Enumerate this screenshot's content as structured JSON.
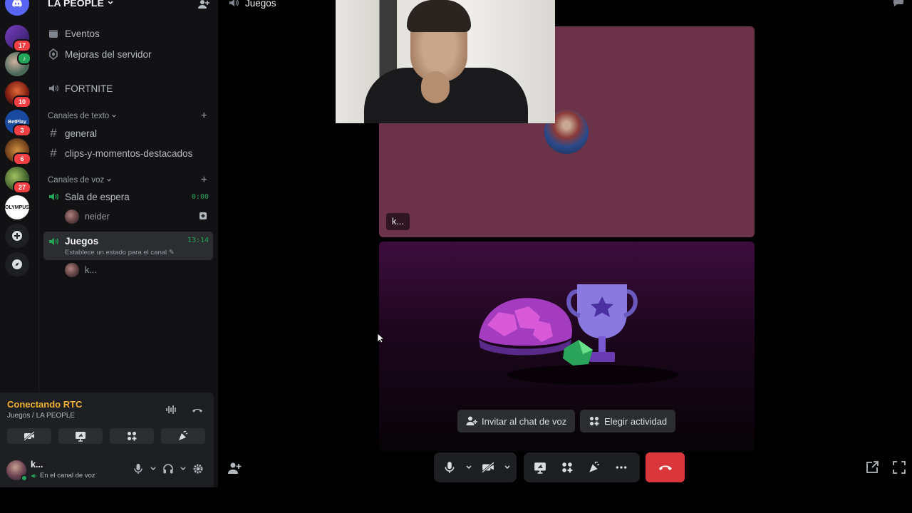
{
  "server": {
    "name": "LA PEOPLE",
    "rail": [
      {
        "name": "server-1",
        "badge": "17",
        "color": "#6b2fa5"
      },
      {
        "name": "server-2",
        "badge": "",
        "color": "#3a6a4a"
      },
      {
        "name": "server-3",
        "badge": "10",
        "color": "#8a2a1a"
      },
      {
        "name": "server-betplay",
        "badge": "3",
        "color": "#1a4aa0"
      },
      {
        "name": "server-5",
        "badge": "6",
        "color": "#8a5a2a"
      },
      {
        "name": "server-6",
        "badge": "27",
        "color": "#5a7a3a"
      },
      {
        "name": "server-olympus",
        "badge": "",
        "color": "#ffffff"
      }
    ]
  },
  "sidebar": {
    "events": "Eventos",
    "boosts": "Mejoras del servidor",
    "fortnite": "FORTNITE",
    "text_category": "Canales de texto",
    "text_channels": [
      "general",
      "clips-y-momentos-destacados"
    ],
    "voice_category": "Canales de voz",
    "waiting_room": "Sala de espera",
    "waiting_timer": "0:00",
    "waiting_user": "neider",
    "active_channel": "Juegos",
    "active_timer": "13:14",
    "active_status": "Establece un estado para el canal",
    "active_user": "k..."
  },
  "voice_panel": {
    "status": "Conectando RTC",
    "location": "Juegos / LA PEOPLE",
    "username": "k...",
    "user_status": "En el canal de voz"
  },
  "stage": {
    "title": "Juegos",
    "tile_label": "k...",
    "invite_button": "Invitar al chat de voz",
    "activity_button": "Elegir actividad"
  },
  "colors": {
    "accent": "#23a559",
    "warning": "#f0b232",
    "tile": "#6b3249",
    "hangup": "#da373c"
  }
}
